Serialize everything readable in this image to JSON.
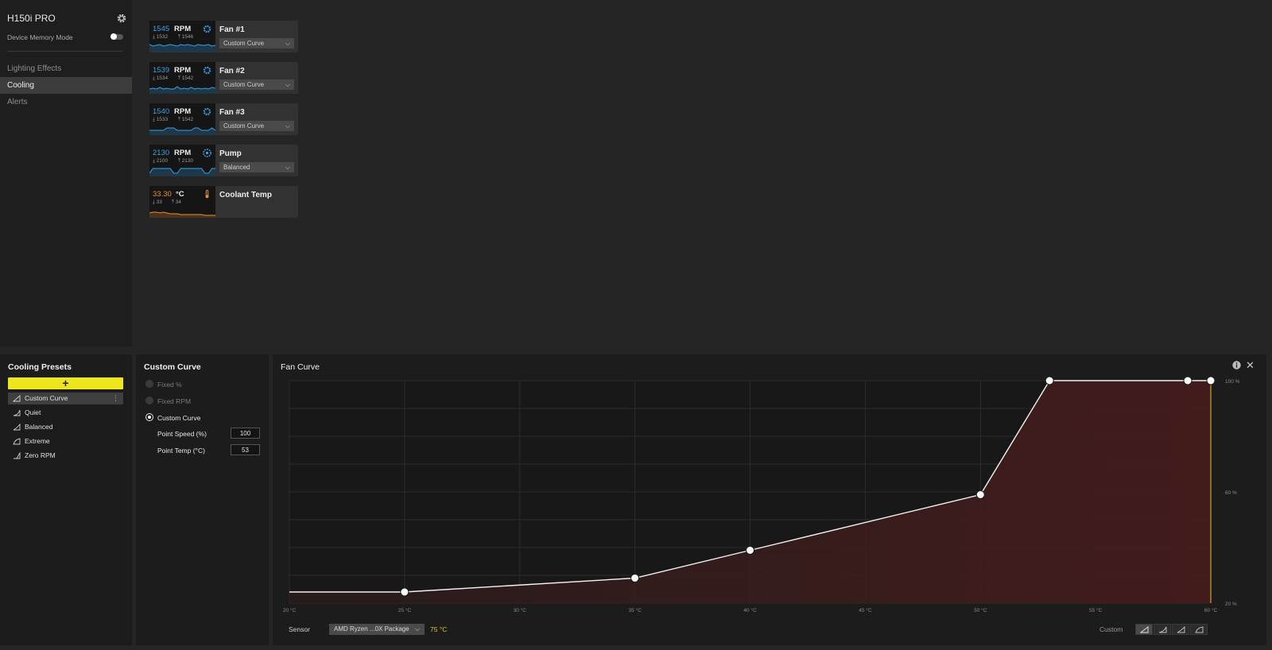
{
  "sidebar": {
    "device_name": "H150i PRO",
    "memory_mode_label": "Device Memory Mode",
    "nav": [
      {
        "label": "Lighting Effects",
        "active": false
      },
      {
        "label": "Cooling",
        "active": true
      },
      {
        "label": "Alerts",
        "active": false
      }
    ]
  },
  "cards": [
    {
      "value": "1545",
      "unit": "RPM",
      "min": "1532",
      "max": "1546",
      "name": "Fan #1",
      "mode": "Custom Curve",
      "color": "#3aa0e8"
    },
    {
      "value": "1539",
      "unit": "RPM",
      "min": "1534",
      "max": "1542",
      "name": "Fan #2",
      "mode": "Custom Curve",
      "color": "#3aa0e8"
    },
    {
      "value": "1540",
      "unit": "RPM",
      "min": "1533",
      "max": "1542",
      "name": "Fan #3",
      "mode": "Custom Curve",
      "color": "#3aa0e8"
    },
    {
      "value": "2130",
      "unit": "RPM",
      "min": "2100",
      "max": "2130",
      "name": "Pump",
      "mode": "Balanced",
      "color": "#3aa0e8"
    },
    {
      "value": "33.30",
      "unit": "°C",
      "min": "33",
      "max": "34",
      "name": "Coolant Temp",
      "mode": "",
      "color": "#e8902a"
    }
  ],
  "presets": {
    "title": "Cooling Presets",
    "add_label": "+",
    "items": [
      {
        "label": "Custom Curve",
        "active": true
      },
      {
        "label": "Quiet",
        "active": false
      },
      {
        "label": "Balanced",
        "active": false
      },
      {
        "label": "Extreme",
        "active": false
      },
      {
        "label": "Zero RPM",
        "active": false
      }
    ]
  },
  "custom": {
    "title": "Custom Curve",
    "options": [
      "Fixed %",
      "Fixed RPM",
      "Custom Curve"
    ],
    "selected": "Custom Curve",
    "point_speed_label": "Point Speed (%)",
    "point_speed": "100",
    "point_temp_label": "Point Temp (°C)",
    "point_temp": "53"
  },
  "fan_curve": {
    "title": "Fan Curve",
    "sensor_label": "Sensor",
    "sensor": "AMD Ryzen ...0X Package",
    "sensor_temp": "75 °C",
    "mode_label": "Custom",
    "accent": "#e3c52c"
  },
  "chart_data": {
    "type": "line",
    "title": "Fan Curve",
    "x_ticks": [
      "20 °C",
      "25 °C",
      "30 °C",
      "35 °C",
      "40 °C",
      "45 °C",
      "50 °C",
      "55 °C",
      "60 °C"
    ],
    "y_ticks": [
      "100 %",
      "60 %",
      "20 %"
    ],
    "xlim": [
      20,
      60
    ],
    "ylim": [
      20,
      100
    ],
    "x": [
      25,
      35,
      40,
      50,
      53,
      59,
      60
    ],
    "y": [
      24,
      29,
      39,
      59,
      100,
      100,
      100
    ],
    "line_extends_to_left_edge": true,
    "fill_color": "#4a1c1c",
    "grid": true,
    "current_temp_marker": 60
  }
}
